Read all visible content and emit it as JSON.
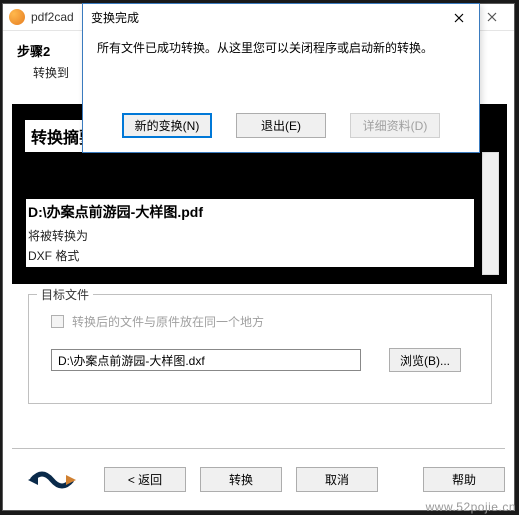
{
  "main": {
    "title": "pdf2cad",
    "step_title": "步骤2",
    "step_sub": "转换到",
    "summary_label": "转换摘要",
    "file_path": "D:\\办案点前游园-大样图.pdf",
    "file_sub1": "将被转换为",
    "file_sub2": "DXF 格式"
  },
  "target": {
    "legend": "目标文件",
    "checkbox_label": "转换后的文件与原件放在同一个地方",
    "path_value": "D:\\办案点前游园-大样图.dxf",
    "browse_label": "浏览(B)..."
  },
  "footer": {
    "back": "< 返回",
    "convert": "转换",
    "cancel": "取消",
    "help": "帮助"
  },
  "modal": {
    "title": "变换完成",
    "message": "所有文件已成功转换。从这里您可以关闭程序或启动新的转换。",
    "btn_new": "新的变换(N)",
    "btn_exit": "退出(E)",
    "btn_detail": "详细资料(D)"
  },
  "watermark": "www.52pojie.cn"
}
